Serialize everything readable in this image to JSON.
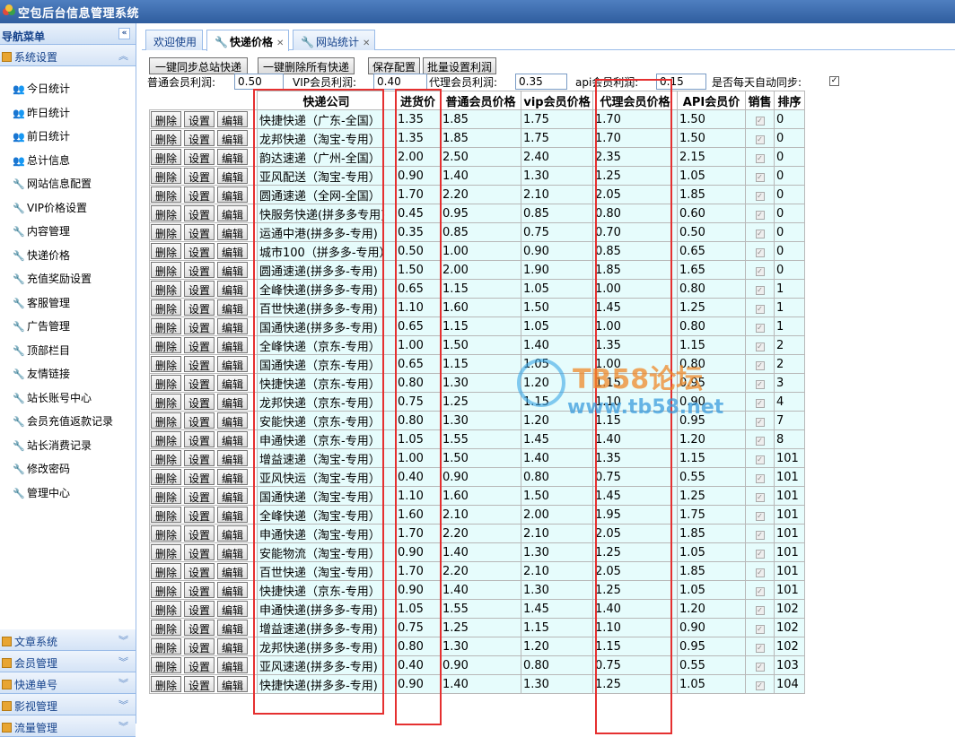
{
  "app": {
    "title": "空包后台信息管理系统"
  },
  "sidebar": {
    "nav_title": "导航菜单",
    "collapse_icon": "double-chevron-left-icon",
    "group_system": "系统设置",
    "items": [
      {
        "label": "今日统计",
        "icon": "users-icon"
      },
      {
        "label": "昨日统计",
        "icon": "users-icon"
      },
      {
        "label": "前日统计",
        "icon": "users-icon"
      },
      {
        "label": "总计信息",
        "icon": "users-icon"
      },
      {
        "label": "网站信息配置",
        "icon": "wrench-icon"
      },
      {
        "label": "VIP价格设置",
        "icon": "wrench-icon"
      },
      {
        "label": "内容管理",
        "icon": "wrench-icon"
      },
      {
        "label": "快递价格",
        "icon": "wrench-icon"
      },
      {
        "label": "充值奖励设置",
        "icon": "wrench-icon"
      },
      {
        "label": "客服管理",
        "icon": "wrench-icon"
      },
      {
        "label": "广告管理",
        "icon": "wrench-icon"
      },
      {
        "label": "顶部栏目",
        "icon": "wrench-icon"
      },
      {
        "label": "友情链接",
        "icon": "wrench-icon"
      },
      {
        "label": "站长账号中心",
        "icon": "wrench-icon"
      },
      {
        "label": "会员充值返款记录",
        "icon": "wrench-icon"
      },
      {
        "label": "站长消费记录",
        "icon": "wrench-icon"
      },
      {
        "label": "修改密码",
        "icon": "wrench-icon"
      },
      {
        "label": "管理中心",
        "icon": "wrench-icon"
      }
    ],
    "bottom_groups": [
      "文章系统",
      "会员管理",
      "快递单号",
      "影视管理",
      "流量管理"
    ]
  },
  "tabs": [
    {
      "label": "欢迎使用"
    },
    {
      "label": "快递价格"
    },
    {
      "label": "网站统计"
    }
  ],
  "toolbar": {
    "sync_label": "一键同步总站快递",
    "delete_all_label": "一键删除所有快递",
    "save_config_label": "保存配置",
    "batch_profit_label": "批量设置利润"
  },
  "profit": {
    "normal_label": "普通会员利润:",
    "normal_value": "0.50",
    "vip_label": "VIP会员利润:",
    "vip_value": "0.40",
    "agent_label": "代理会员利润:",
    "agent_value": "0.35",
    "api_label": "api会员利润:",
    "api_value": "0.15",
    "sync_daily_label": "是否每天自动同步:",
    "sync_daily_checked": true
  },
  "table": {
    "headers": [
      "快递公司",
      "进货价",
      "普通会员价格",
      "vip会员价格",
      "代理会员价格",
      "API会员价",
      "销售",
      "排序"
    ],
    "row_buttons": [
      "删除",
      "设置",
      "编辑"
    ],
    "rows": [
      [
        "快捷快递（广东-全国）",
        "1.35",
        "1.85",
        "1.75",
        "1.70",
        "1.50",
        "0"
      ],
      [
        "龙邦快递（淘宝-专用）",
        "1.35",
        "1.85",
        "1.75",
        "1.70",
        "1.50",
        "0"
      ],
      [
        "韵达速递（广州-全国）",
        "2.00",
        "2.50",
        "2.40",
        "2.35",
        "2.15",
        "0"
      ],
      [
        "亚风配送（淘宝-专用）",
        "0.90",
        "1.40",
        "1.30",
        "1.25",
        "1.05",
        "0"
      ],
      [
        "圆通速递（全网-全国）",
        "1.70",
        "2.20",
        "2.10",
        "2.05",
        "1.85",
        "0"
      ],
      [
        "快服务快递(拼多多专用)",
        "0.45",
        "0.95",
        "0.85",
        "0.80",
        "0.60",
        "0"
      ],
      [
        "运通中港(拼多多-专用)",
        "0.35",
        "0.85",
        "0.75",
        "0.70",
        "0.50",
        "0"
      ],
      [
        "城市100（拼多多-专用）",
        "0.50",
        "1.00",
        "0.90",
        "0.85",
        "0.65",
        "0"
      ],
      [
        "圆通速递(拼多多-专用)",
        "1.50",
        "2.00",
        "1.90",
        "1.85",
        "1.65",
        "0"
      ],
      [
        "全峰快递(拼多多-专用)",
        "0.65",
        "1.15",
        "1.05",
        "1.00",
        "0.80",
        "1"
      ],
      [
        "百世快递(拼多多-专用)",
        "1.10",
        "1.60",
        "1.50",
        "1.45",
        "1.25",
        "1"
      ],
      [
        "国通快递(拼多多-专用)",
        "0.65",
        "1.15",
        "1.05",
        "1.00",
        "0.80",
        "1"
      ],
      [
        "全峰快递（京东-专用）",
        "1.00",
        "1.50",
        "1.40",
        "1.35",
        "1.15",
        "2"
      ],
      [
        "国通快递（京东-专用）",
        "0.65",
        "1.15",
        "1.05",
        "1.00",
        "0.80",
        "2"
      ],
      [
        "快捷快递（京东-专用）",
        "0.80",
        "1.30",
        "1.20",
        "1.15",
        "0.95",
        "3"
      ],
      [
        "龙邦快递（京东-专用）",
        "0.75",
        "1.25",
        "1.15",
        "1.10",
        "0.90",
        "4"
      ],
      [
        "安能快递（京东-专用）",
        "0.80",
        "1.30",
        "1.20",
        "1.15",
        "0.95",
        "7"
      ],
      [
        "申通快递（京东-专用）",
        "1.05",
        "1.55",
        "1.45",
        "1.40",
        "1.20",
        "8"
      ],
      [
        "增益速递（淘宝-专用）",
        "1.00",
        "1.50",
        "1.40",
        "1.35",
        "1.15",
        "101"
      ],
      [
        "亚风快运（淘宝-专用）",
        "0.40",
        "0.90",
        "0.80",
        "0.75",
        "0.55",
        "101"
      ],
      [
        "国通快递（淘宝-专用）",
        "1.10",
        "1.60",
        "1.50",
        "1.45",
        "1.25",
        "101"
      ],
      [
        "全峰快递（淘宝-专用）",
        "1.60",
        "2.10",
        "2.00",
        "1.95",
        "1.75",
        "101"
      ],
      [
        "申通快递（淘宝-专用）",
        "1.70",
        "2.20",
        "2.10",
        "2.05",
        "1.85",
        "101"
      ],
      [
        "安能物流（淘宝-专用）",
        "0.90",
        "1.40",
        "1.30",
        "1.25",
        "1.05",
        "101"
      ],
      [
        "百世快递（淘宝-专用）",
        "1.70",
        "2.20",
        "2.10",
        "2.05",
        "1.85",
        "101"
      ],
      [
        "快捷快递（京东-专用）",
        "0.90",
        "1.40",
        "1.30",
        "1.25",
        "1.05",
        "101"
      ],
      [
        "申通快递(拼多多-专用)",
        "1.05",
        "1.55",
        "1.45",
        "1.40",
        "1.20",
        "102"
      ],
      [
        "增益速递(拼多多-专用)",
        "0.75",
        "1.25",
        "1.15",
        "1.10",
        "0.90",
        "102"
      ],
      [
        "龙邦快递(拼多多-专用)",
        "0.80",
        "1.30",
        "1.20",
        "1.15",
        "0.95",
        "102"
      ],
      [
        "亚风速递(拼多多-专用)",
        "0.40",
        "0.90",
        "0.80",
        "0.75",
        "0.55",
        "103"
      ],
      [
        "快捷快递(拼多多-专用)",
        "0.90",
        "1.40",
        "1.30",
        "1.25",
        "1.05",
        "104"
      ]
    ]
  },
  "watermark": {
    "line1": "TB58论坛",
    "line2": "www.tb58.net"
  },
  "colors": {
    "accent": "#2f5d9e",
    "cell_bg": "#e6fcfc",
    "highlight_box": "#e53030"
  }
}
